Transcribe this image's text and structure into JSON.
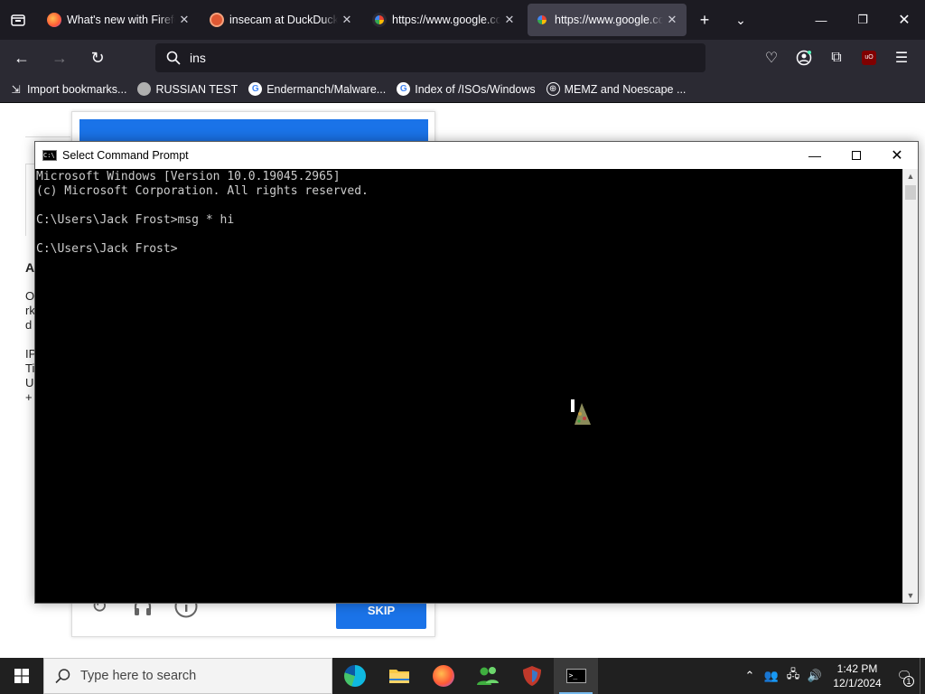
{
  "browser": {
    "tabs": [
      {
        "title": "What's new with Firefox",
        "favicon": "firefox-icon",
        "active": false
      },
      {
        "title": "insecam at DuckDuckGo",
        "favicon": "duckduckgo-icon",
        "active": false
      },
      {
        "title": "https://www.google.com",
        "favicon": "google-icon",
        "active": false
      },
      {
        "title": "https://www.google.com",
        "favicon": "google-icon",
        "active": true
      }
    ],
    "url_value": "ins",
    "bookmarks": [
      {
        "label": "Import bookmarks...",
        "icon": "import-icon"
      },
      {
        "label": "RUSSIAN TEST",
        "icon": "github-icon"
      },
      {
        "label": "Endermanch/Malware...",
        "icon": "google-icon"
      },
      {
        "label": "Index of /ISOs/Windows",
        "icon": "google-icon"
      },
      {
        "label": "MEMZ and Noescape ...",
        "icon": "globe-icon"
      }
    ]
  },
  "page": {
    "left_text": [
      "A",
      "O",
      "rk",
      "d",
      "IP",
      "Ti",
      "U",
      "+"
    ],
    "skip_label": "SKIP"
  },
  "cmd": {
    "title": "Select Command Prompt",
    "lines": [
      "Microsoft Windows [Version 10.0.19045.2965]",
      "(c) Microsoft Corporation. All rights reserved.",
      "",
      "C:\\Users\\Jack Frost>msg * hi",
      "",
      "C:\\Users\\Jack Frost>"
    ]
  },
  "taskbar": {
    "search_placeholder": "Type here to search",
    "time": "1:42 PM",
    "date": "12/1/2024",
    "notification_count": "1"
  },
  "colors": {
    "accent": "#1a73e8",
    "firefox_dark": "#1c1b22",
    "taskbar": "#202020"
  }
}
